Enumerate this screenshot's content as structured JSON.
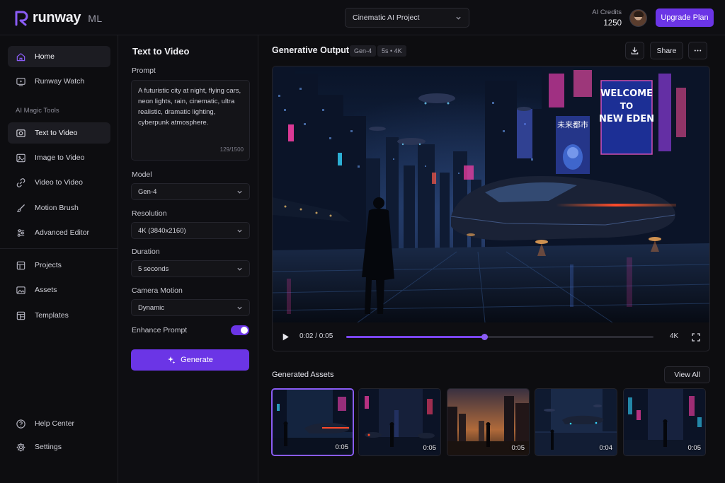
{
  "app": {
    "logo_text": "runway",
    "logo_suffix": "ML",
    "project": "Cinematic AI Project",
    "credits_label": "AI Credits",
    "credits_value": "1250",
    "upgrade_label": "Upgrade Plan"
  },
  "sidebar": {
    "top_items": [
      {
        "label": "Home",
        "icon": "home-icon",
        "active": true
      },
      {
        "label": "Runway Watch",
        "icon": "tv-icon",
        "active": false
      }
    ],
    "section_label": "AI Magic Tools",
    "tools": [
      {
        "label": "Text to Video",
        "icon": "camera-icon",
        "active": true
      },
      {
        "label": "Image to Video",
        "icon": "image-icon",
        "active": false
      },
      {
        "label": "Video to Video",
        "icon": "link-icon",
        "active": false
      },
      {
        "label": "Motion Brush",
        "icon": "brush-icon",
        "active": false
      },
      {
        "label": "Advanced Editor",
        "icon": "sliders-icon",
        "active": false
      }
    ],
    "library": [
      {
        "label": "Projects",
        "icon": "folder-icon"
      },
      {
        "label": "Assets",
        "icon": "picture-icon"
      },
      {
        "label": "Templates",
        "icon": "template-icon"
      }
    ],
    "footer": [
      {
        "label": "Help Center",
        "icon": "help-icon"
      },
      {
        "label": "Settings",
        "icon": "gear-icon"
      }
    ]
  },
  "panel": {
    "title": "Text to Video",
    "prompt_label": "Prompt",
    "prompt_value": "A futuristic city at night, flying cars, neon lights, rain, cinematic, ultra realistic, dramatic lighting, cyberpunk atmosphere.",
    "prompt_count": "129/1500",
    "model_label": "Model",
    "model_value": "Gen-4",
    "resolution_label": "Resolution",
    "resolution_value": "4K (3840x2160)",
    "duration_label": "Duration",
    "duration_value": "5 seconds",
    "camera_label": "Camera Motion",
    "camera_value": "Dynamic",
    "enhance_label": "Enhance Prompt",
    "enhance_on": true,
    "generate_label": "Generate"
  },
  "output": {
    "title": "Generative Output",
    "chip_model": "Gen-4",
    "chip_meta": "5s  •  4K",
    "share_label": "Share",
    "billboard_line1": "WELCOME",
    "billboard_line2": "TO",
    "billboard_line3": "NEW EDEN",
    "billboard_kanji": "未来都市",
    "time": "0:02 / 0:05",
    "progress": 0.45,
    "resolution": "4K"
  },
  "assets": {
    "title": "Generated Assets",
    "view_all": "View All",
    "items": [
      {
        "duration": "0:05",
        "selected": true
      },
      {
        "duration": "0:05",
        "selected": false
      },
      {
        "duration": "0:05",
        "selected": false
      },
      {
        "duration": "0:04",
        "selected": false
      },
      {
        "duration": "0:05",
        "selected": false
      }
    ]
  },
  "colors": {
    "accent": "#6b35e6",
    "accent_light": "#8a5cf5",
    "background": "#0d0d10",
    "neon_pink": "#ff3fa8",
    "neon_cyan": "#34d6ff"
  }
}
